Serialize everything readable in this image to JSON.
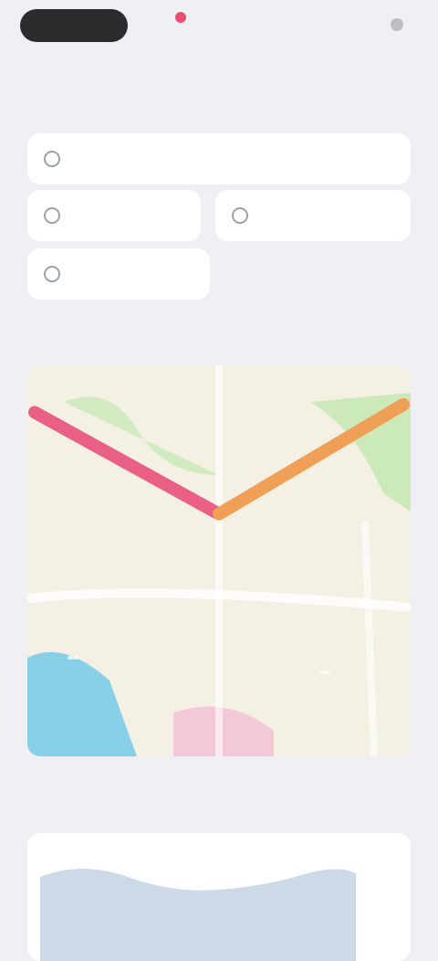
{
  "header": {
    "back_label": "",
    "center_text": "",
    "right_text": "",
    "title": ""
  },
  "details": {
    "section_title": "",
    "items": [
      {
        "label": ""
      },
      {
        "label": ""
      },
      {
        "label": ""
      },
      {
        "label": ""
      }
    ]
  },
  "map": {
    "section_title": "",
    "labels": [
      "",
      ""
    ],
    "route_colors": [
      "#ea5f85",
      "#f0a056"
    ],
    "route_points": [
      [
        0.0,
        0.12
      ],
      [
        0.5,
        0.38
      ],
      [
        1.0,
        0.1
      ]
    ]
  },
  "chart_section": {
    "title": "",
    "action": ""
  },
  "colors": {
    "background": "#efeff4",
    "card": "#ffffff",
    "accent_pink": "#ea5f85",
    "accent_orange": "#f0a056",
    "chart_fill": "#c9d8e6"
  }
}
